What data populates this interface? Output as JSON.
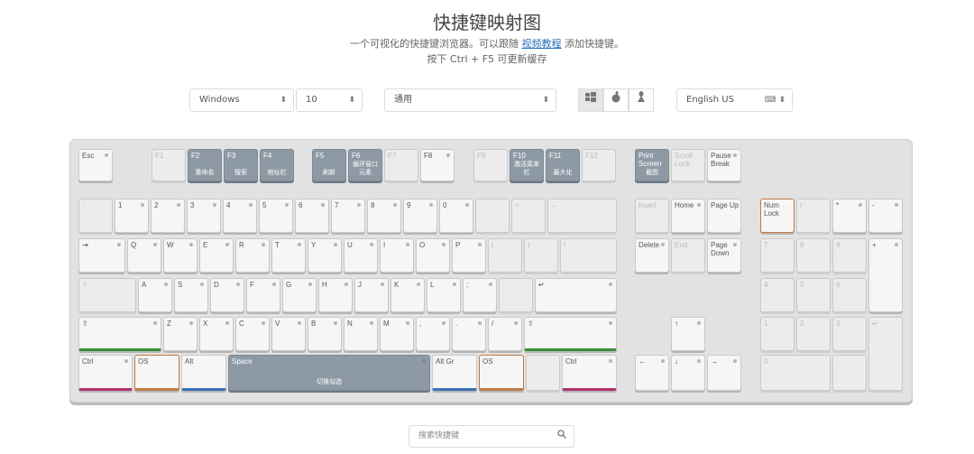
{
  "header": {
    "title": "快捷键映射图",
    "subtitle_a": "一个可视化的快捷键浏览器。可以跟随",
    "tutorial_link": "视频教程",
    "subtitle_b": "添加快捷键。",
    "hint": "按下 Ctrl + F5 可更新缓存"
  },
  "toolbar": {
    "os_select": "Windows",
    "version_select": "10",
    "app_select": "通用",
    "os_icons": [
      "windows-icon",
      "apple-icon",
      "linux-icon"
    ],
    "layout_select": "English US",
    "keyboard_icon": "⌨"
  },
  "search": {
    "placeholder": "搜索快捷键"
  },
  "keys": {
    "esc": "Esc",
    "f1": "F1",
    "f2": "F2",
    "f3": "F3",
    "f4": "F4",
    "f5": "F5",
    "f6": "F6",
    "f7": "F7",
    "f8": "F8",
    "f9": "F9",
    "f10": "F10",
    "f11": "F11",
    "f12": "F12",
    "print": "Print\nScreen",
    "scroll": "Scroll\nLock",
    "pause": "Pause\nBreak",
    "backtick": "`",
    "n1": "1",
    "n2": "2",
    "n3": "3",
    "n4": "4",
    "n5": "5",
    "n6": "6",
    "n7": "7",
    "n8": "8",
    "n9": "9",
    "n0": "0",
    "minus": "-",
    "equals": "=",
    "backspace": "←",
    "insert": "Insert",
    "home": "Home",
    "pageup": "Page Up",
    "numlock": "Num\nLock",
    "npslash": "/",
    "npstar": "*",
    "npminus": "-",
    "tab": "⇥",
    "q": "Q",
    "w": "W",
    "e": "E",
    "r": "R",
    "t": "T",
    "y": "Y",
    "u": "U",
    "i": "I",
    "o": "O",
    "p": "P",
    "lbracket": "[",
    "rbracket": "]",
    "backslash": "\\",
    "delete": "Delete",
    "end": "End",
    "pagedown": "Page\nDown",
    "np7": "7",
    "np8": "8",
    "np9": "9",
    "npplus": "+",
    "caps": "⇪",
    "a": "A",
    "s": "S",
    "d": "D",
    "f": "F",
    "g": "G",
    "h": "H",
    "j": "J",
    "k": "K",
    "l": "L",
    "semicolon": ";",
    "quote": "'",
    "enter": "↵",
    "np4": "4",
    "np5": "5",
    "np6": "6",
    "lshift": "⇧",
    "z": "Z",
    "x": "X",
    "c": "C",
    "v": "V",
    "b": "B",
    "n": "N",
    "m": "M",
    "comma": ",",
    "period": ".",
    "slash": "/",
    "rshift": "⇧",
    "up": "↑",
    "np1": "1",
    "np2": "2",
    "np3": "3",
    "npenter": "↵",
    "lctrl": "Ctrl",
    "los": "OS",
    "lalt": "Alt",
    "space": "Space",
    "altgr": "Alt Gr",
    "ros": "OS",
    "rctrl": "Ctrl",
    "left": "←",
    "down": "↓",
    "right": "→",
    "np0": "0",
    "npdot": "."
  },
  "actions": {
    "f2": "重命名",
    "f3": "搜索",
    "f4": "地址栏",
    "f5": "刷新",
    "f6": "循环窗口\n元素",
    "f10": "激活菜单\n栏",
    "f11": "最大化",
    "print": "截图",
    "space": "切换勾选"
  },
  "colors": {
    "highlight": "#8d9aa6",
    "green": "#3a8d3a",
    "orange": "#c07a45",
    "pink": "#b3306e",
    "blue": "#3a72b8"
  }
}
